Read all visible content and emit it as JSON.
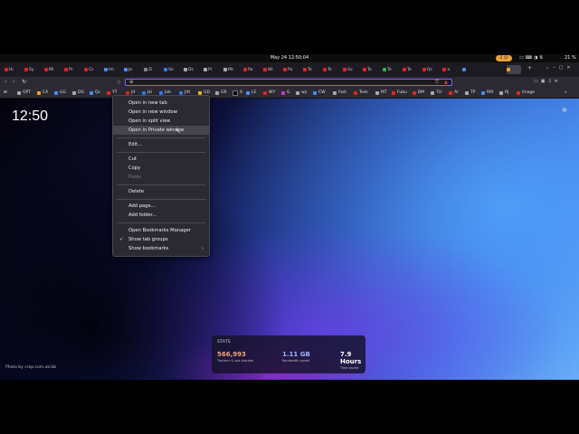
{
  "system_bar": {
    "clock": "May 24  12:50:04",
    "badge": "2 ☺",
    "battery": "21 %"
  },
  "tabs": [
    "Hi",
    "Sy",
    "Mi",
    "Pr",
    "Cc",
    "Im",
    "Je",
    "Zi",
    "Se",
    "Dc",
    "Pr",
    "Mc",
    "Pa",
    "Wi",
    "Pa",
    "Te",
    "Te",
    "Gc",
    "Te",
    "Te",
    "Te",
    "Qc",
    "×"
  ],
  "tab_plus": "+",
  "toolbar": {
    "back": "‹",
    "forward": "›",
    "reload": "↻"
  },
  "bookmarks": [
    "GPT",
    "CA",
    "GG",
    "DG",
    "Qc",
    "YT",
    "Jit",
    "Jki",
    "Job",
    "Jitt",
    "GD",
    "GR",
    "X",
    "LE",
    "WY",
    "G",
    "wy",
    "CW",
    "Fast",
    "Tesk",
    "MT",
    "Fubu",
    "BM",
    "TU",
    "AI",
    "TP",
    "RM",
    "RJ",
    "Image"
  ],
  "page": {
    "clock": "12:50",
    "photo_credit": "Photo by crop.com.uk/ab"
  },
  "stats": {
    "title": "STATS",
    "items": [
      {
        "value": "566,993",
        "label": "Trackers & ads blocked",
        "color": "#f0a87a"
      },
      {
        "value": "1.11 GB",
        "label": "Bandwidth saved",
        "color": "#9fb6ff"
      },
      {
        "value": "7.9 Hours",
        "label": "Time saved",
        "color": "#ffffff"
      }
    ]
  },
  "context_menu": {
    "items": [
      {
        "label": "Open in new tab"
      },
      {
        "label": "Open in new window"
      },
      {
        "label": "Open in split view"
      },
      {
        "label": "Open in Private window"
      },
      {
        "label": "Edit..."
      },
      {
        "label": "Cut"
      },
      {
        "label": "Copy"
      },
      {
        "label": "Paste"
      },
      {
        "label": "Delete"
      },
      {
        "label": "Add page..."
      },
      {
        "label": "Add folder..."
      },
      {
        "label": "Open Bookmarks Manager"
      },
      {
        "label": "Show tab groups"
      },
      {
        "label": "Show bookmarks"
      }
    ]
  }
}
